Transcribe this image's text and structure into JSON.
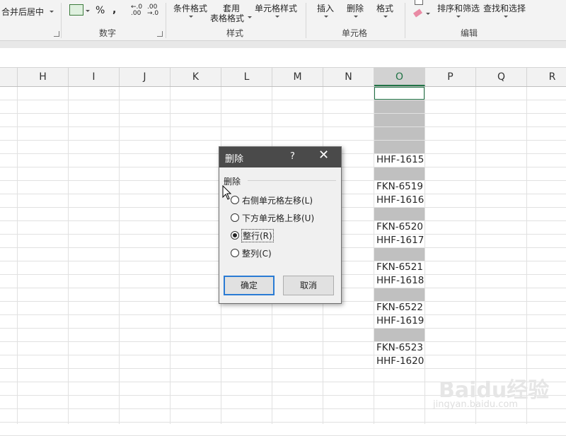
{
  "ribbon": {
    "merge_center_label": "合并后居中",
    "percent_symbol": "%",
    "comma_symbol": ",",
    "decimal_increase": "←.0\n.00",
    "decimal_decrease": ".00\n→.0",
    "number_group": "数字",
    "conditional_format": "条件格式",
    "table_format_top": "套用",
    "table_format_bottom": "表格格式",
    "cell_styles": "单元格样式",
    "styles_group": "样式",
    "insert": "插入",
    "delete": "删除",
    "format": "格式",
    "cells_group": "单元格",
    "sort_filter": "排序和筛选",
    "find_select": "查找和选择",
    "editing_group": "编辑"
  },
  "columns": [
    "H",
    "I",
    "J",
    "K",
    "L",
    "M",
    "N",
    "O",
    "P",
    "Q",
    "R"
  ],
  "selected_column": "O",
  "column_o_values": [
    {
      "row": 5,
      "text": "HHF-1615"
    },
    {
      "row": 7,
      "text": "FKN-6519"
    },
    {
      "row": 8,
      "text": "HHF-1616"
    },
    {
      "row": 10,
      "text": "FKN-6520"
    },
    {
      "row": 11,
      "text": "HHF-1617"
    },
    {
      "row": 13,
      "text": "FKN-6521"
    },
    {
      "row": 14,
      "text": "HHF-1618"
    },
    {
      "row": 16,
      "text": "FKN-6522"
    },
    {
      "row": 17,
      "text": "HHF-1619"
    },
    {
      "row": 19,
      "text": "FKN-6523"
    },
    {
      "row": 20,
      "text": "HHF-1620"
    }
  ],
  "dialog": {
    "title": "删除",
    "help": "?",
    "close": "✕",
    "group_label": "删除",
    "options": [
      {
        "label": "右侧单元格左移(L)",
        "selected": false
      },
      {
        "label": "下方单元格上移(U)",
        "selected": false
      },
      {
        "label": "整行(R)",
        "selected": true
      },
      {
        "label": "整列(C)",
        "selected": false
      }
    ],
    "ok": "确定",
    "cancel": "取消"
  },
  "watermark": {
    "logo": "Baidu经验",
    "url": "jingyan.baidu.com"
  },
  "colors": {
    "accent": "#217346",
    "selected_fill": "#c0c0c0",
    "dialog_title": "#4a4a4a",
    "default_button_border": "#2a7bd4"
  }
}
